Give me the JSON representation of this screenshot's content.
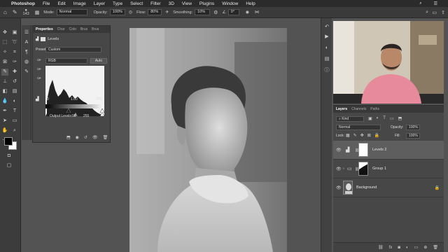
{
  "menubar": {
    "apple": "",
    "items": [
      "Photoshop",
      "File",
      "Edit",
      "Image",
      "Layer",
      "Type",
      "Select",
      "Filter",
      "3D",
      "View",
      "Plugins",
      "Window",
      "Help"
    ]
  },
  "options": {
    "brush_size": "143",
    "mode_label": "Mode:",
    "mode_value": "Normal",
    "opacity_label": "Opacity:",
    "opacity_value": "100%",
    "flow_label": "Flow:",
    "flow_value": "80%",
    "smoothing_label": "Smoothing:",
    "smoothing_value": "10%",
    "angle_value": "0°"
  },
  "properties": {
    "tabs": [
      "Properties",
      "Char",
      "Colo",
      "Brus",
      "Brus"
    ],
    "adjustment_name": "Levels",
    "preset_label": "Preset:",
    "preset_value": "Custom",
    "channel_value": "RGB",
    "auto_button": "Auto",
    "input_black": "0",
    "input_gamma": "1.00",
    "input_white": "255",
    "output_label": "Output Levels:",
    "output_black": "98",
    "output_white": "255"
  },
  "layers_panel": {
    "tabs": [
      "Layers",
      "Channels",
      "Paths"
    ],
    "filter_kind": "Kind",
    "blend_mode": "Normal",
    "opacity_label": "Opacity:",
    "opacity_value": "100%",
    "lock_label": "Lock:",
    "fill_label": "Fill:",
    "fill_value": "100%",
    "layers": [
      {
        "name": "Levels 2",
        "selected": true
      },
      {
        "name": "Group 1",
        "selected": false
      },
      {
        "name": "Background",
        "selected": false
      }
    ]
  },
  "colors": {
    "accent": "#1473e6",
    "panel_bg": "#474747",
    "menubar_bg": "#2b2b2b"
  }
}
